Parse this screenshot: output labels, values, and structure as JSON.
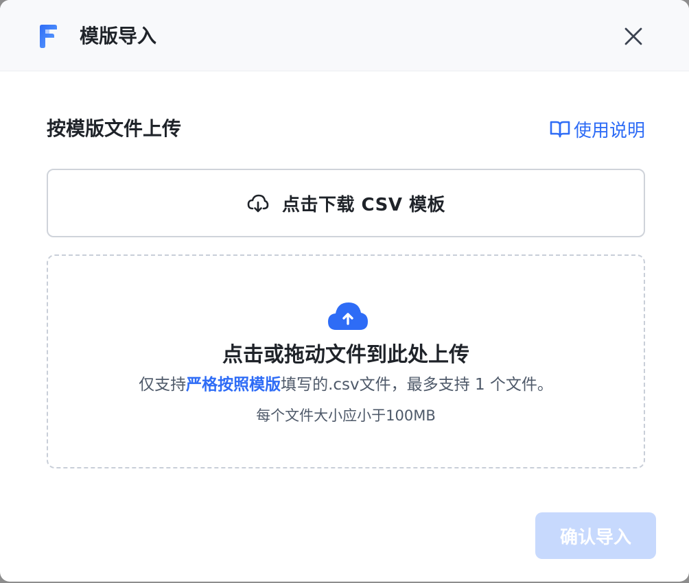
{
  "dialog": {
    "title": "模版导入",
    "close_icon": "close-icon",
    "logo_icon": "brand-logo-icon"
  },
  "section": {
    "title": "按模版文件上传",
    "help_link": "使用说明",
    "help_icon": "book-icon"
  },
  "download": {
    "label": "点击下载 CSV 模板",
    "icon": "cloud-download-icon"
  },
  "dropzone": {
    "icon": "cloud-upload-icon",
    "title": "点击或拖动文件到此处上传",
    "desc_prefix": "仅支持",
    "desc_highlight": "严格按照模版",
    "desc_suffix": "填写的.csv文件，最多支持 1 个文件。",
    "limit": "每个文件大小应小于100MB"
  },
  "footer": {
    "confirm_label": "确认导入"
  },
  "colors": {
    "accent": "#2e6cf6",
    "disabled_button": "#c7d9fd",
    "header_bg": "#f8f9fb"
  }
}
